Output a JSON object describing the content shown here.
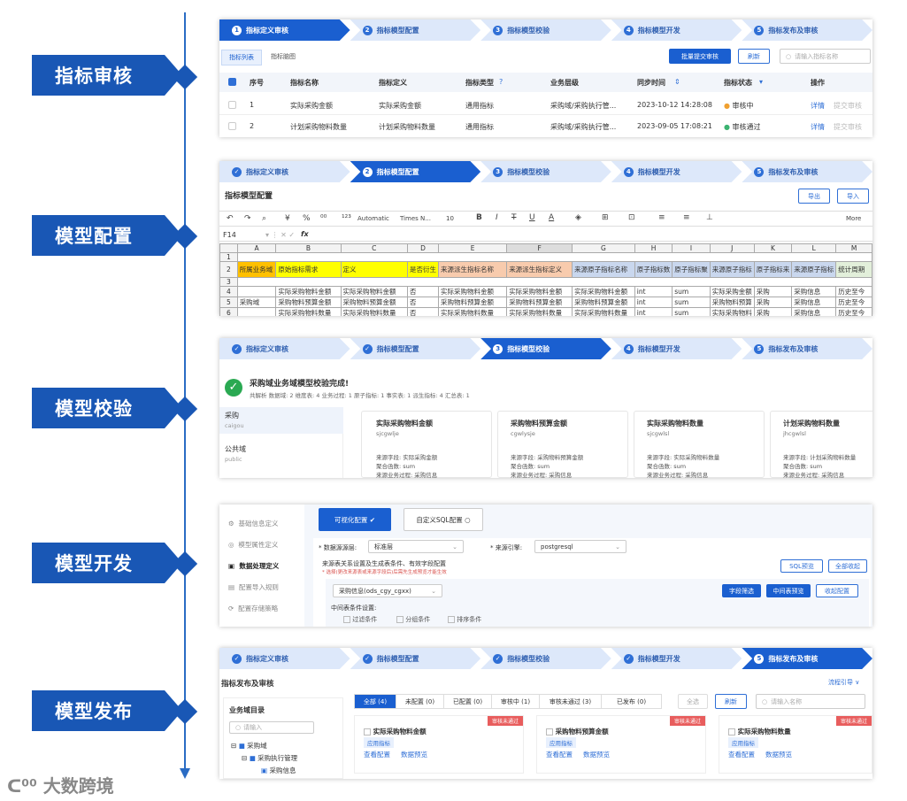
{
  "stages": [
    "指标审核",
    "模型配置",
    "模型校验",
    "模型开发",
    "模型发布"
  ],
  "steps": [
    "指标定义审核",
    "指标模型配置",
    "指标模型校验",
    "指标模型开发",
    "指标发布及审核"
  ],
  "p1": {
    "tabs": [
      "指标列表",
      "指标脑图"
    ],
    "batch": "批量提交审核",
    "refresh": "刷新",
    "search": "请输入指标名称",
    "headers": [
      "序号",
      "指标名称",
      "指标定义",
      "指标类型",
      "业务层级",
      "同步时间",
      "指标状态",
      "操作"
    ],
    "rows": [
      {
        "no": "1",
        "name": "实际采购金额",
        "def": "实际采购金额",
        "type": "通用指标",
        "level": "采购域/采购执行管...",
        "time": "2023-10-12 14:28:08",
        "status": "审核中",
        "op1": "详情",
        "op2": "提交审核"
      },
      {
        "no": "2",
        "name": "计划采购物料数量",
        "def": "计划采购物料数量",
        "type": "通用指标",
        "level": "采购域/采购执行管...",
        "time": "2023-09-05 17:08:21",
        "status": "审核通过",
        "op1": "详情",
        "op2": "提交审核"
      }
    ],
    "colors": {
      "pending": "#f0a030",
      "passed": "#3cb371"
    }
  },
  "p2": {
    "title": "指标模型配置",
    "export": "导出",
    "import": "导入",
    "cellref": "F14",
    "fx": "fx",
    "toolbar": {
      "auto": "Automatic",
      "font": "Times N...",
      "size": "10",
      "more": "More"
    },
    "cols": [
      "A",
      "B",
      "C",
      "D",
      "E",
      "F",
      "G",
      "H",
      "I",
      "J",
      "K",
      "L",
      "M"
    ],
    "header": [
      "所属业务域",
      "原始指标需求",
      "定义",
      "是否衍生",
      "来源派生指标名称",
      "来源派生指标定义",
      "来源原子指标名称",
      "原子指标数",
      "原子指标聚",
      "来源原子指标",
      "原子指标来",
      "来源原子指标",
      "统计周期"
    ],
    "rows": [
      [
        "",
        "实际采购物料金额",
        "实际采购物料金额",
        "否",
        "实际采购物料金额",
        "实际采购物料金额",
        "实际采购物料金额",
        "int",
        "sum",
        "实际采购金额",
        "采购",
        "采购信息",
        "历史至今"
      ],
      [
        "采购域",
        "采购物料预算金额",
        "采购物料预算金额",
        "否",
        "采购物料预算金额",
        "采购物料预算金额",
        "采购物料预算金额",
        "int",
        "sum",
        "采购物料预算",
        "采购",
        "采购信息",
        "历史至今"
      ],
      [
        "",
        "实际采购物料数量",
        "实际采购物料数量",
        "否",
        "实际采购物料数量",
        "实际采购物料数量",
        "实际采购物料数量",
        "int",
        "sum",
        "实际采购物料",
        "采购",
        "采购信息",
        "历史至今"
      ]
    ]
  },
  "p3": {
    "title": "采购域业务域模型校验完成!",
    "summary": "共解析  数据域: 2   维度表: 4   业务过程: 1   原子指标: 1   事实表: 1   派生指标: 4   汇总表: 1",
    "side": [
      {
        "name": "采购",
        "code": "caigou"
      },
      {
        "name": "公共域",
        "code": "public"
      }
    ],
    "cards": [
      {
        "name": "实际采购物料金额",
        "code": "sjcgwlje",
        "f1": "来源字段:  实际采购金额",
        "f2": "聚合函数:  sum",
        "f3": "来源业务过程:  采购信息"
      },
      {
        "name": "采购物料预算金额",
        "code": "cgwlysje",
        "f1": "来源字段:  采购物料预算金额",
        "f2": "聚合函数:  sum",
        "f3": "来源业务过程:  采购信息"
      },
      {
        "name": "实际采购物料数量",
        "code": "sjcgwlsl",
        "f1": "来源字段:  实际采购物料数量",
        "f2": "聚合函数:  sum",
        "f3": "来源业务过程:  采购信息"
      },
      {
        "name": "计划采购物料数量",
        "code": "jhcgwlsl",
        "f1": "来源字段:  计划采购物料数量",
        "f2": "聚合函数:  sum",
        "f3": "来源业务过程:  采购信息"
      }
    ]
  },
  "p4": {
    "menu": [
      "基础信息定义",
      "模型属性定义",
      "数据处理定义",
      "配置导入规则",
      "配置存储策略"
    ],
    "tab1": "可视化配置",
    "tab2": "自定义SQL配置",
    "dslabel": "* 数据源源层:",
    "dsval": "标准层",
    "enginelabel": "* 来源引擎:",
    "engineval": "postgresql",
    "desc": "来源表关系设置及生成表条件、有效字段配置",
    "note": "* 选择(更改来源表或来源字段后)后需先生成预览才能生效",
    "sqlpreview": "SQL预览",
    "collapse": "全部收起",
    "table": "采购信息(ods_cgy_cgxx)",
    "fieldsel": "字段筛选",
    "midpreview": "中间表预览",
    "collapsecfg": "收起配置",
    "condlabel": "中间表条件设置:",
    "conds": [
      "过滤条件",
      "分组条件",
      "排序条件"
    ]
  },
  "p5": {
    "title": "指标发布及审核",
    "flow": "流程引导 ∨",
    "tabs": [
      "全部 (4)",
      "未配置 (0)",
      "已配置 (0)",
      "审核中 (1)",
      "审核未通过 (3)",
      "已发布 (0)"
    ],
    "selall": "全选",
    "refresh": "刷新",
    "search": "请输入名称",
    "treetitle": "业务域目录",
    "treesearch": "请输入",
    "tree": [
      "采购域",
      "采购执行管理",
      "采购信息"
    ],
    "cards": [
      {
        "name": "实际采购物料金额",
        "tag": "应用指标",
        "badge": "审核未通过",
        "a1": "查看配置",
        "a2": "数据预览"
      },
      {
        "name": "采购物料预算金额",
        "tag": "应用指标",
        "badge": "审核未通过",
        "a1": "查看配置",
        "a2": "数据预览"
      },
      {
        "name": "实际采购物料数量",
        "tag": "应用指标",
        "badge": "审核未通过",
        "a1": "查看配置",
        "a2": "数据预览"
      }
    ]
  },
  "logo": "大数跨境"
}
